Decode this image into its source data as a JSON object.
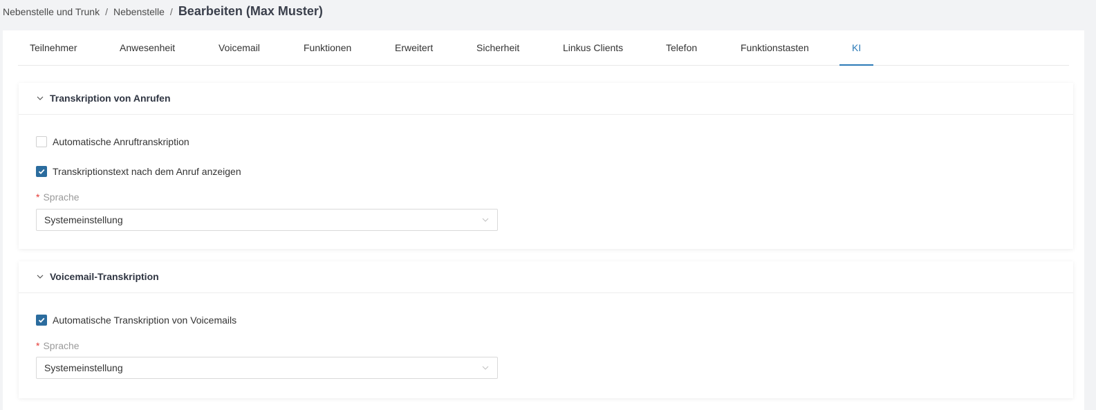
{
  "breadcrumb": {
    "items": [
      "Nebenstelle und Trunk",
      "Nebenstelle"
    ],
    "separator": "/",
    "current": "Bearbeiten (Max Muster)"
  },
  "tabs": [
    {
      "label": "Teilnehmer",
      "active": false
    },
    {
      "label": "Anwesenheit",
      "active": false
    },
    {
      "label": "Voicemail",
      "active": false
    },
    {
      "label": "Funktionen",
      "active": false
    },
    {
      "label": "Erweitert",
      "active": false
    },
    {
      "label": "Sicherheit",
      "active": false
    },
    {
      "label": "Linkus Clients",
      "active": false
    },
    {
      "label": "Telefon",
      "active": false
    },
    {
      "label": "Funktionstasten",
      "active": false
    },
    {
      "label": "KI",
      "active": true
    }
  ],
  "call_transcription": {
    "title": "Transkription von Anrufen",
    "auto_transcription": {
      "label": "Automatische Anruftranskription",
      "checked": false
    },
    "show_text": {
      "label": "Transkriptionstext nach dem Anruf anzeigen",
      "checked": true
    },
    "language": {
      "label": "Sprache",
      "required_mark": "*",
      "value": "Systemeinstellung"
    }
  },
  "voicemail_transcription": {
    "title": "Voicemail-Transkription",
    "auto_transcription": {
      "label": "Automatische Transkription von Voicemails",
      "checked": true
    },
    "language": {
      "label": "Sprache",
      "required_mark": "*",
      "value": "Systemeinstellung"
    }
  },
  "colors": {
    "accent": "#2b7ab7",
    "checkbox_checked": "#2b6c9e",
    "required": "#e53935",
    "background": "#f2f3f5"
  },
  "icons": {
    "panel_toggle": "chevron-down-icon",
    "select_arrow": "chevron-down-icon",
    "checkmark": "check-icon"
  }
}
